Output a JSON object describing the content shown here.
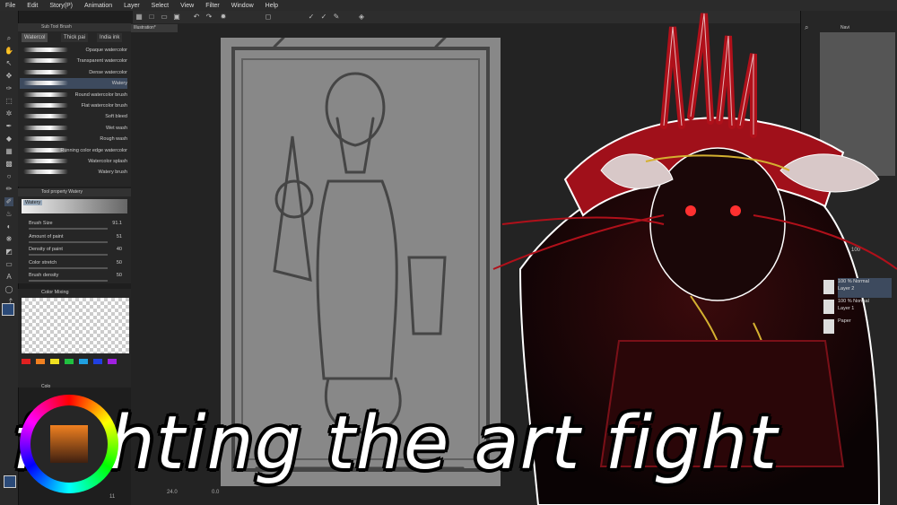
{
  "menu": [
    "File",
    "Edit",
    "Story(P)",
    "Animation",
    "Layer",
    "Select",
    "View",
    "Filter",
    "Window",
    "Help"
  ],
  "document_tab": "Illustration*",
  "subtool": {
    "header": "Sub Tool Brush",
    "tabs": [
      "Watercol",
      "Thick pai",
      "India ink"
    ],
    "brushes": [
      "Opaque watercolor",
      "Transparent watercolor",
      "Dense watercolor",
      "Watery",
      "Round watercolor brush",
      "Flat watercolor brush",
      "Soft bleed",
      "Wet wash",
      "Rough wash",
      "Running color edge watercolor",
      "Watercolor splash",
      "Watery brush"
    ],
    "selected_index": 3
  },
  "tool_property": {
    "header": "Tool property Watery",
    "preset": "Watery",
    "props": [
      {
        "label": "Brush Size",
        "value": "91.1"
      },
      {
        "label": "Amount of paint",
        "value": "51"
      },
      {
        "label": "Density of paint",
        "value": "40"
      },
      {
        "label": "Color stretch",
        "value": "50"
      },
      {
        "label": "Brush density",
        "value": "50"
      }
    ]
  },
  "color_mixing": {
    "header": "Color Mixing"
  },
  "color_wheel": {
    "header": "Colo"
  },
  "status": {
    "zoom": "24.0",
    "angle": "0.0",
    "count": "11"
  },
  "layers": [
    {
      "mode": "100 % Normal",
      "name": "Layer 2",
      "selected": true
    },
    {
      "mode": "100 % Normal",
      "name": "Layer 1",
      "selected": false
    },
    {
      "mode": "",
      "name": "Paper",
      "selected": false
    }
  ],
  "opacity_value": "100",
  "navigator_header": "Navi",
  "title": "fighting the art fight",
  "colors": {
    "accent_select": "#3d4a5e",
    "crimson": "#b0101a",
    "gold": "#d4b030"
  }
}
